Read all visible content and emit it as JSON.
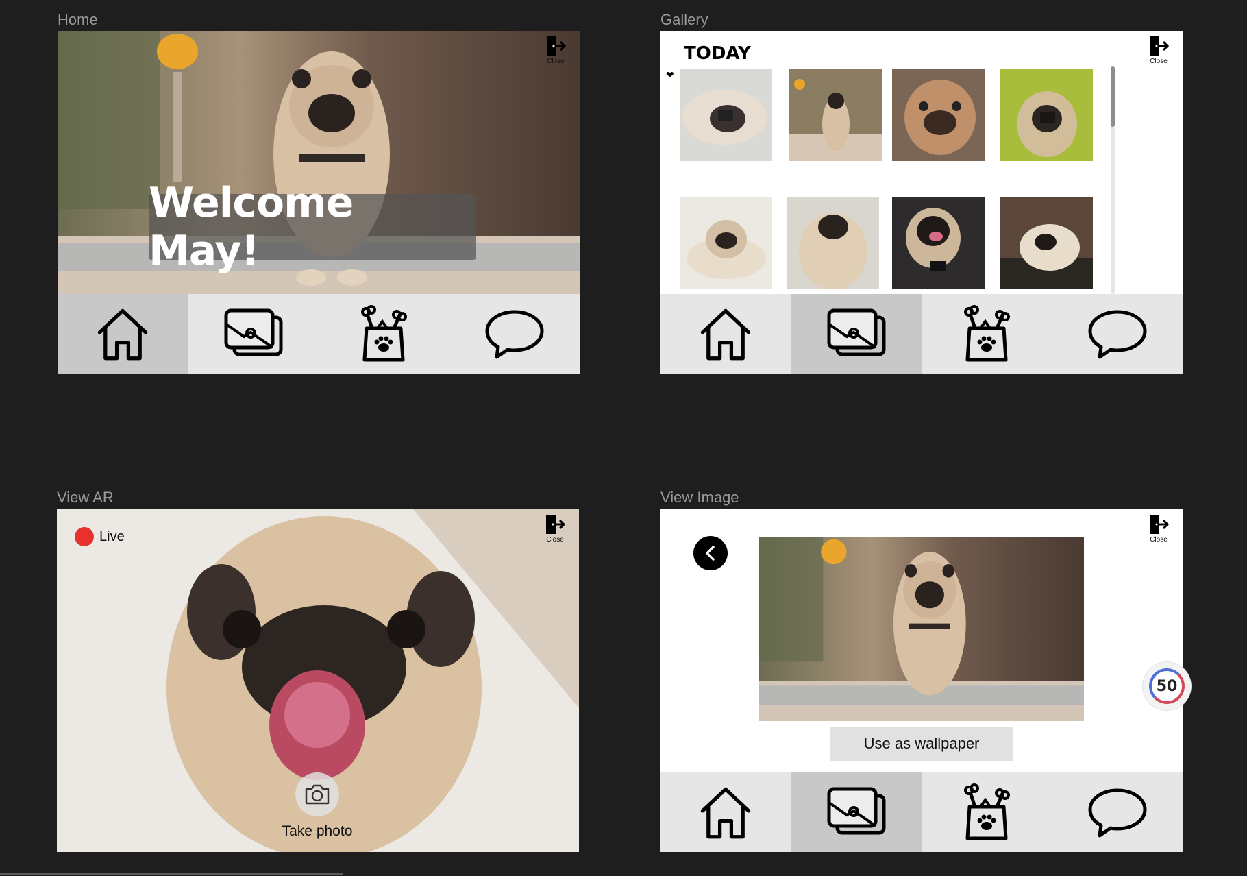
{
  "frames": {
    "home": {
      "label": "Home",
      "welcome": "Welcome May!",
      "close_label": "Close"
    },
    "gallery": {
      "label": "Gallery",
      "section_title": "TODAY",
      "close_label": "Close"
    },
    "ar": {
      "label": "View AR",
      "live_label": "Live",
      "take_photo_label": "Take photo",
      "close_label": "Close"
    },
    "view_image": {
      "label": "View Image",
      "wallpaper_label": "Use as wallpaper",
      "close_label": "Close"
    }
  },
  "nav": {
    "items": [
      "home-icon",
      "gallery-icon",
      "pet-food-icon",
      "chat-icon"
    ]
  },
  "badge": {
    "value": "50"
  },
  "colors": {
    "canvas": "#1e1e1e",
    "nav_bg": "#e6e6e6",
    "nav_active": "#c8c8c8",
    "live_red": "#e8312c"
  }
}
